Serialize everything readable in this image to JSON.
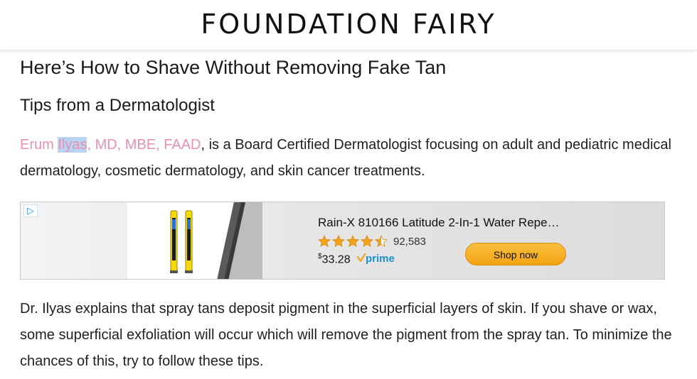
{
  "site": {
    "logo_text": "FOUNDATION FAIRY"
  },
  "article": {
    "title": "Here’s How to Shave Without Removing Fake Tan",
    "subtitle": "Tips from a Dermatologist",
    "intro": {
      "name_first": "Erum ",
      "name_highlighted": "Ilyas",
      "name_credentials": ", MD, MBE, FAAD",
      "rest": ", is a Board Certified Dermatologist focusing on adult and pediatric medical dermatology, cosmetic dermatology, and skin cancer treatments."
    },
    "body_paragraph": "Dr. Ilyas explains that spray tans deposit pigment in the superficial layers of skin. If you shave or wax, some superficial exfoliation will occur which will remove the pigment from the spray tan. To minimize the chances of this, try to follow these tips."
  },
  "ad": {
    "choice_icon": "ad-choices-icon",
    "product_title": "Rain-X 810166 Latitude 2-In-1 Water Repe…",
    "rating_stars": 4.5,
    "rating_count": "92,583",
    "price_currency": "$",
    "price_value": "33.28",
    "prime_label": "prime",
    "shop_button": "Shop now"
  },
  "colors": {
    "link_pink": "#e890b3",
    "highlight": "#b9d3f3",
    "star_orange": "#f4a41b",
    "button_orange": "#f7b22d",
    "prime_blue": "#1b8fd1"
  }
}
